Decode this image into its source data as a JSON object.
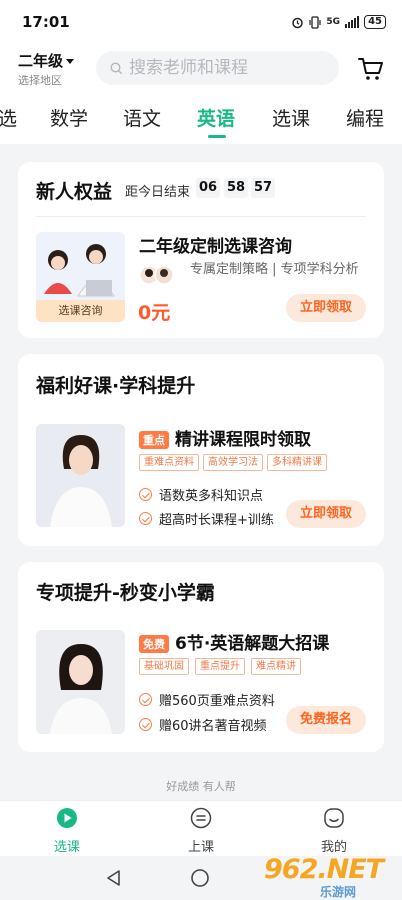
{
  "status_bar": {
    "time": "17:01",
    "network": "5G",
    "battery": "45"
  },
  "header": {
    "grade": "二年级",
    "region": "选择地区",
    "search_placeholder": "搜索老师和课程"
  },
  "subject_tabs": [
    {
      "label": "选",
      "active": false
    },
    {
      "label": "数学",
      "active": false
    },
    {
      "label": "语文",
      "active": false
    },
    {
      "label": "英语",
      "active": true
    },
    {
      "label": "选课",
      "active": false
    },
    {
      "label": "编程",
      "active": false
    }
  ],
  "newbie_card": {
    "title": "新人权益",
    "countdown_label": "距今日结束",
    "hours": "06",
    "minutes": "58",
    "seconds": "57",
    "item": {
      "title": "二年级定制选课咨询",
      "thumb_caption": "选课咨询",
      "desc": "专属定制策略 | 专项学科分析",
      "price": "0元",
      "button": "立即领取"
    }
  },
  "welfare_card": {
    "title": "福利好课·学科提升",
    "item": {
      "badge": "重点",
      "title": "精讲课程限时领取",
      "tags": [
        "重难点资料",
        "高效学习法",
        "多科精讲课"
      ],
      "features": [
        "语数英多科知识点",
        "超高时长课程+训练"
      ],
      "button": "立即领取"
    }
  },
  "special_card": {
    "title": "专项提升-秒变小学霸",
    "item": {
      "badge": "免费",
      "title": "6节·英语解题大招课",
      "tags": [
        "基础巩固",
        "重点提升",
        "难点精讲"
      ],
      "features": [
        "赠560页重难点资料",
        "赠60讲名著音视频"
      ],
      "button": "免费报名"
    }
  },
  "footer_note": "好成绩 有人帮",
  "bottom_nav": [
    {
      "label": "选课",
      "icon": "play-icon",
      "active": true
    },
    {
      "label": "上课",
      "icon": "list-icon",
      "active": false
    },
    {
      "label": "我的",
      "icon": "smile-icon",
      "active": false
    }
  ],
  "watermark": {
    "text": "962.NET",
    "sub": "乐游网"
  },
  "colors": {
    "accent": "#19b889",
    "orange": "#ff6420",
    "price": "#ff5a2c"
  }
}
